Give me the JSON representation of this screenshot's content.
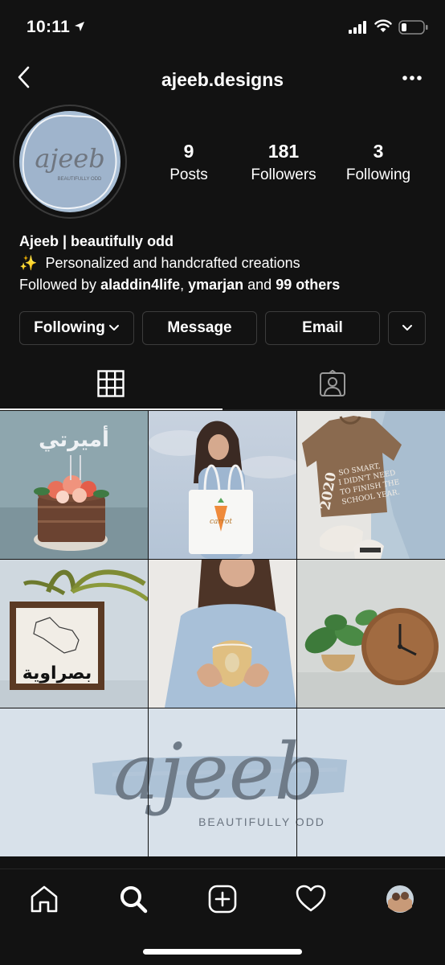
{
  "status_bar": {
    "time": "10:11"
  },
  "header": {
    "username": "ajeeb.designs"
  },
  "profile": {
    "avatar_text": "ajeeb",
    "avatar_subtext": "BEAUTIFULLY ODD",
    "stats": [
      {
        "value": "9",
        "label": "Posts"
      },
      {
        "value": "181",
        "label": "Followers"
      },
      {
        "value": "3",
        "label": "Following"
      }
    ],
    "bio": {
      "name": "Ajeeb | beautifully odd",
      "sparkle": "✨",
      "description": "Personalized and handcrafted creations",
      "followed_prefix": "Followed by ",
      "followed_user1": "aladdin4life",
      "followed_sep": ", ",
      "followed_user2": "ymarjan",
      "followed_and": " and ",
      "followed_others": "99 others"
    }
  },
  "actions": {
    "following_label": "Following",
    "message_label": "Message",
    "email_label": "Email"
  },
  "tabs": {
    "active": "grid"
  },
  "posts": {
    "post1_text": "أميرتي",
    "post3_text": [
      "2020",
      "SO SMART,",
      "I DIDN'T NEED",
      "TO FINISH THE",
      "SCHOOL YEAR."
    ],
    "post4_text": "بصراوية",
    "banner_logo": "ajeeb",
    "banner_sub": "BEAUTIFULLY ODD"
  },
  "colors": {
    "background": "#121212",
    "accent_blue": "#a9bfd6",
    "button_border": "#3c3c3c"
  }
}
